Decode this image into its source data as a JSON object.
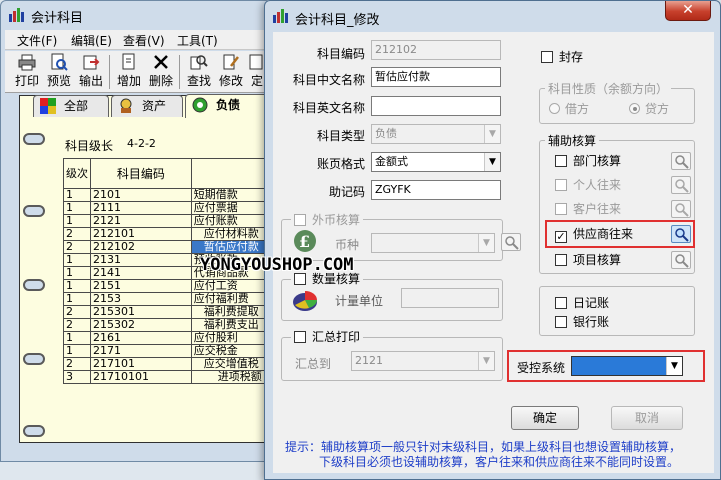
{
  "back_window": {
    "title": "会计科目",
    "menu": [
      "文件(F)",
      "编辑(E)",
      "查看(V)",
      "工具(T)"
    ],
    "toolbar": [
      "打印",
      "预览",
      "输出",
      "增加",
      "删除",
      "查找",
      "修改",
      "定"
    ],
    "tabs": [
      "全部",
      "资产",
      "负债"
    ],
    "level_label": "科目级长",
    "level_value": "4-2-2",
    "table": {
      "headers": [
        "级次",
        "科目编码"
      ],
      "rows": [
        {
          "level": "1",
          "code": "2101",
          "name": "短期借款"
        },
        {
          "level": "1",
          "code": "2111",
          "name": "应付票据"
        },
        {
          "level": "1",
          "code": "2121",
          "name": "应付账款"
        },
        {
          "level": "2",
          "code": "212101",
          "name": "应付材料款"
        },
        {
          "level": "2",
          "code": "212102",
          "name": "暂估应付款"
        },
        {
          "level": "1",
          "code": "2131",
          "name": "预收账款"
        },
        {
          "level": "1",
          "code": "2141",
          "name": "代销商品款"
        },
        {
          "level": "1",
          "code": "2151",
          "name": "应付工资"
        },
        {
          "level": "1",
          "code": "2153",
          "name": "应付福利费"
        },
        {
          "level": "2",
          "code": "215301",
          "name": "福利费提取"
        },
        {
          "level": "2",
          "code": "215302",
          "name": "福利费支出"
        },
        {
          "level": "1",
          "code": "2161",
          "name": "应付股利"
        },
        {
          "level": "1",
          "code": "2171",
          "name": "应交税金"
        },
        {
          "level": "2",
          "code": "217101",
          "name": "应交增值税"
        },
        {
          "level": "3",
          "code": "21710101",
          "name": "进项税额"
        }
      ]
    }
  },
  "dialog": {
    "title": "会计科目_修改",
    "close": "✕",
    "code_label": "科目编码",
    "code_value": "212102",
    "cn_name_label": "科目中文名称",
    "cn_name_value": "暂估应付款",
    "en_name_label": "科目英文名称",
    "en_name_value": "",
    "type_label": "科目类型",
    "type_value": "负债",
    "format_label": "账页格式",
    "format_value": "金额式",
    "mnemonic_label": "助记码",
    "mnemonic_value": "ZGYFK",
    "fx_group": "外币核算",
    "currency_label": "币种",
    "qty_group": "数量核算",
    "unit_label": "计量单位",
    "summary_group": "汇总打印",
    "summary_to_label": "汇总到",
    "summary_to_value": "2121",
    "sealed_label": "封存",
    "nature_group": "科目性质（余额方向）",
    "debit_label": "借方",
    "credit_label": "贷方",
    "aux_group": "辅助核算",
    "aux_items": [
      {
        "label": "部门核算",
        "checked": false,
        "enabled": true
      },
      {
        "label": "个人往来",
        "checked": false,
        "enabled": false
      },
      {
        "label": "客户往来",
        "checked": false,
        "enabled": false
      },
      {
        "label": "供应商往来",
        "checked": true,
        "enabled": true
      },
      {
        "label": "项目核算",
        "checked": false,
        "enabled": true
      }
    ],
    "journal_label": "日记账",
    "bank_label": "银行账",
    "controlled_label": "受控系统",
    "controlled_value": "",
    "ok_label": "确定",
    "cancel_label": "取消",
    "hint_line1": "提示：辅助核算项一般只针对末级科目，如果上级科目也想设置辅助核算，",
    "hint_line2": "下级科目必须也设辅助核算，客户往来和供应商往来不能同时设置。",
    "watermark": "YONGYOUSHOP.COM"
  },
  "colors": {
    "accent_red": "#e03030",
    "selection_blue": "#3a78c8",
    "hint_blue": "#1e3ec8"
  }
}
